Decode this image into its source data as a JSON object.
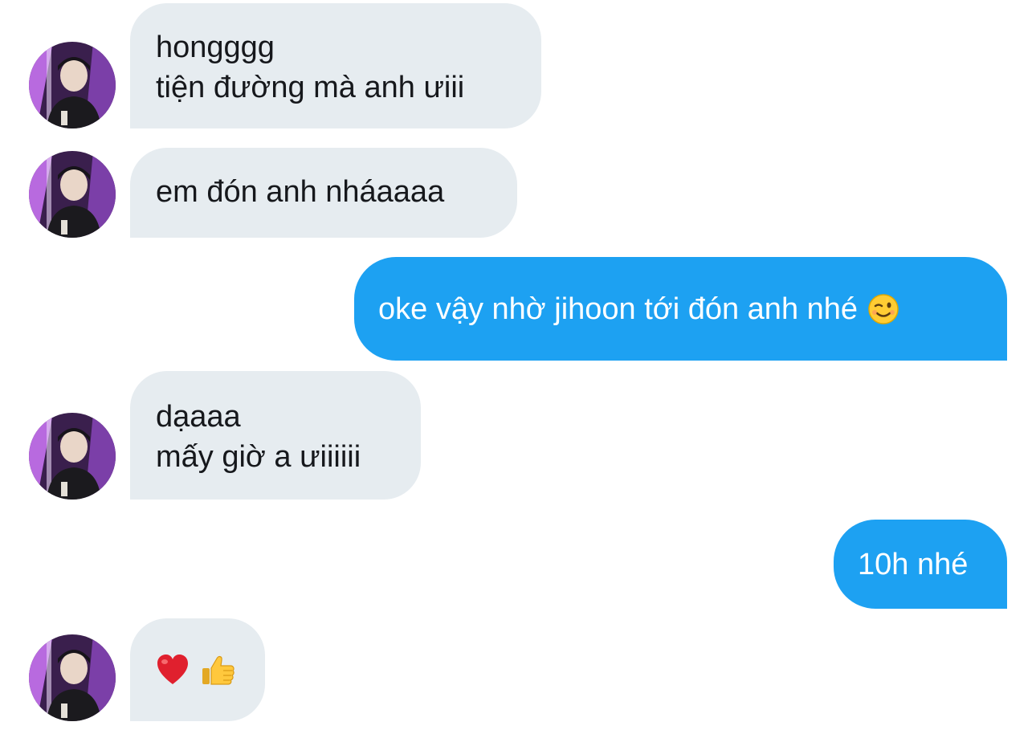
{
  "conversation": {
    "messages": [
      {
        "direction": "incoming",
        "lines": [
          "hongggg",
          "tiện đường mà anh ưiii"
        ]
      },
      {
        "direction": "incoming",
        "lines": [
          "em đón anh nháaaaa"
        ]
      },
      {
        "direction": "outgoing",
        "text": "oke vậy nhờ jihoon tới đón anh nhé",
        "emoji": "winking-face-emoji"
      },
      {
        "direction": "incoming",
        "lines": [
          "dạaaa",
          "mấy giờ a ưiiiiii"
        ]
      },
      {
        "direction": "outgoing",
        "text": "10h nhé"
      },
      {
        "direction": "incoming",
        "emojis": [
          "red-heart-emoji",
          "thumbs-up-emoji"
        ]
      }
    ]
  },
  "colors": {
    "incoming_bubble": "#e6ecf0",
    "outgoing_bubble": "#1da1f2",
    "incoming_text": "#16181c",
    "outgoing_text": "#ffffff"
  }
}
